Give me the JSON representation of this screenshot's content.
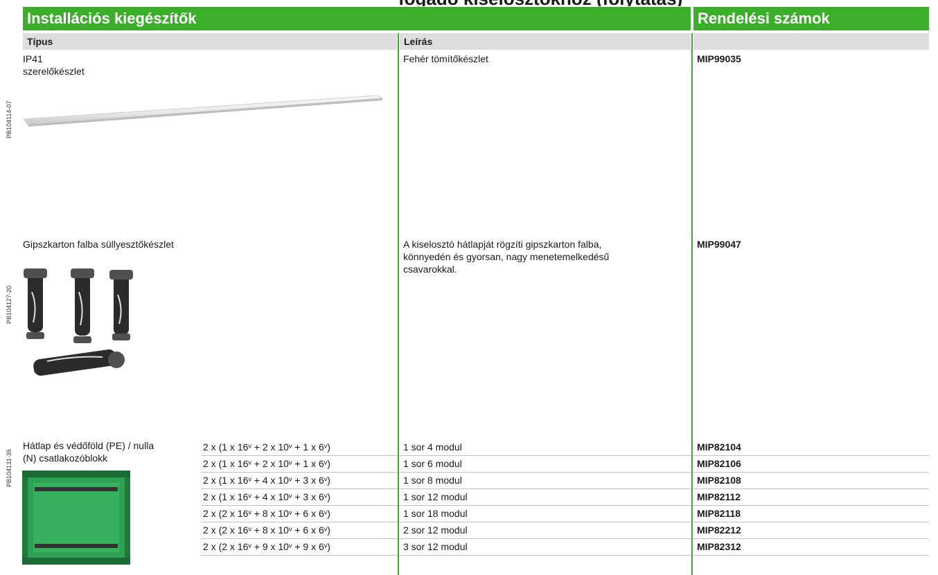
{
  "cut_title": "fogadó kiselosztókhoz (folytatás)",
  "header": {
    "left": "Installációs kiegészítők",
    "right": "Rendelési számok"
  },
  "subheader": {
    "type": "Típus",
    "description": "Leírás"
  },
  "side_codes": [
    "PB104114-07",
    "PB104127-20",
    "PB104131-35"
  ],
  "rows": {
    "ip41": {
      "type_line1": "IP41",
      "type_line2": "szerelőkészlet",
      "description": "Fehér tömítőkészlet",
      "code": "MIP99035"
    },
    "gipsz": {
      "type": "Gipszkarton falba süllyesztőkészlet",
      "description_lines": [
        "A kiselosztó hátlapját rögzíti gipszkarton falba,",
        "könnyedén és gyorsan, nagy menetemelkedésű",
        "csavarokkal."
      ],
      "code": "MIP99047"
    },
    "hatlap": {
      "type_line1": "Hátlap és védőföld (PE) / nulla",
      "type_line2": "(N) csatlakozóblokk",
      "items": [
        {
          "spec": "2 x (1 x 16ᵛ + 2 x 10ᵛ + 1 x 6ᵛ)",
          "desc": "1 sor 4 modul",
          "code": "MIP82104"
        },
        {
          "spec": "2 x (1 x 16ᵛ + 2 x 10ᵛ + 1 x 6ᵛ)",
          "desc": "1 sor 6 modul",
          "code": "MIP82106"
        },
        {
          "spec": "2 x (1 x 16ᵛ + 4 x 10ᵛ + 3 x 6ᵛ)",
          "desc": "1 sor 8 modul",
          "code": "MIP82108"
        },
        {
          "spec": "2 x (1 x 16ᵛ + 4 x 10ᵛ + 3 x 6ᵛ)",
          "desc": "1 sor 12 modul",
          "code": "MIP82112"
        },
        {
          "spec": "2 x (2 x 16ᵛ + 8 x 10ᵛ + 6 x 6ᵛ)",
          "desc": "1 sor 18 modul",
          "code": "MIP82118"
        },
        {
          "spec": "2 x (2 x 16ᵛ + 8 x 10ᵛ + 6 x 6ᵛ)",
          "desc": "2 sor 12 modul",
          "code": "MIP82212"
        },
        {
          "spec": "2 x (2 x 16ᵛ + 9 x 10ᵛ + 9 x 6ᵛ)",
          "desc": "3 sor 12 modul",
          "code": "MIP82312"
        }
      ]
    }
  }
}
